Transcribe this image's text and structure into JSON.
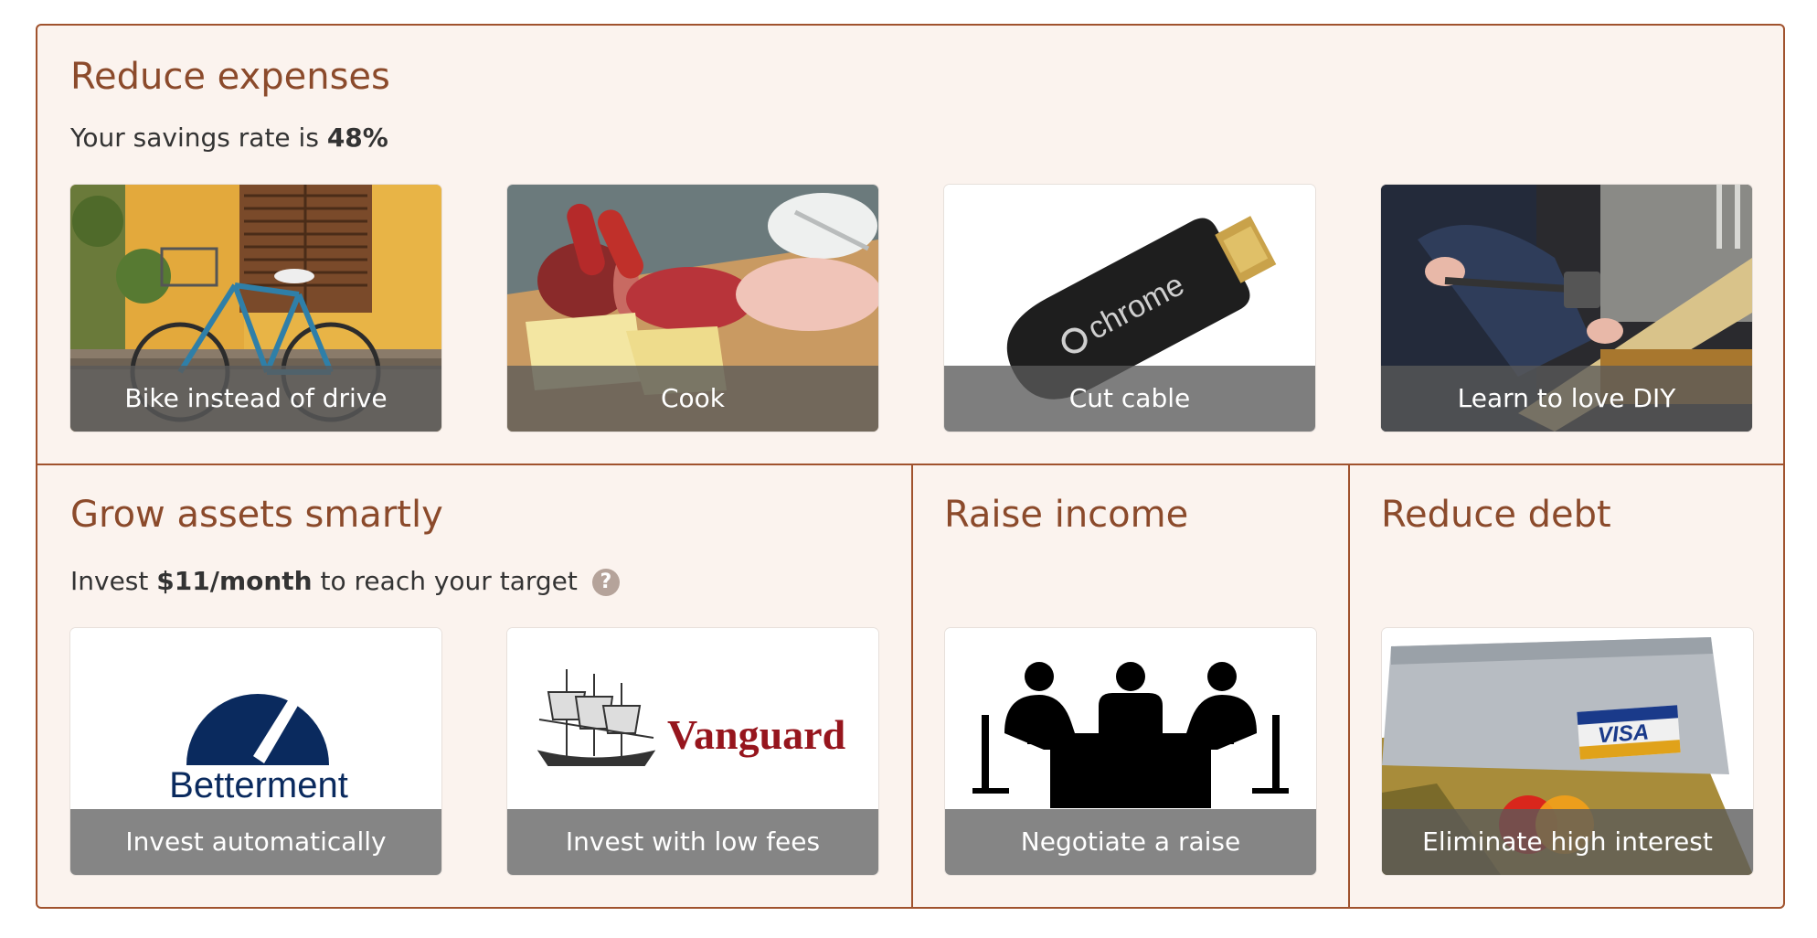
{
  "reduce_expenses": {
    "title": "Reduce expenses",
    "savings_prefix": "Your savings rate is ",
    "savings_rate": "48%",
    "cards": [
      {
        "label": "Bike instead of drive",
        "image": "bicycle-photo"
      },
      {
        "label": "Cook",
        "image": "food-photo"
      },
      {
        "label": "Cut cable",
        "image": "chromecast-photo"
      },
      {
        "label": "Learn to love DIY",
        "image": "hammer-photo"
      }
    ]
  },
  "grow_assets": {
    "title": "Grow assets smartly",
    "invest_prefix": "Invest ",
    "invest_amount": "$11/month",
    "invest_suffix": " to reach your target",
    "help_icon": "?",
    "cards": [
      {
        "label": "Invest automatically",
        "logo_text": "Betterment"
      },
      {
        "label": "Invest with low fees",
        "logo_text": "Vanguard"
      }
    ]
  },
  "raise_income": {
    "title": "Raise income",
    "cards": [
      {
        "label": "Negotiate a raise",
        "image": "meeting-icon"
      }
    ]
  },
  "reduce_debt": {
    "title": "Reduce debt",
    "cards": [
      {
        "label": "Eliminate high interest",
        "image": "credit-cards-photo",
        "card_text": "VISA"
      }
    ]
  },
  "colors": {
    "accent": "#8b4a2b",
    "border": "#a0522d",
    "panel_bg": "#fbf3ee",
    "caption_bg": "#858585",
    "betterment_navy": "#0a2a5e",
    "vanguard_red": "#96151d"
  }
}
